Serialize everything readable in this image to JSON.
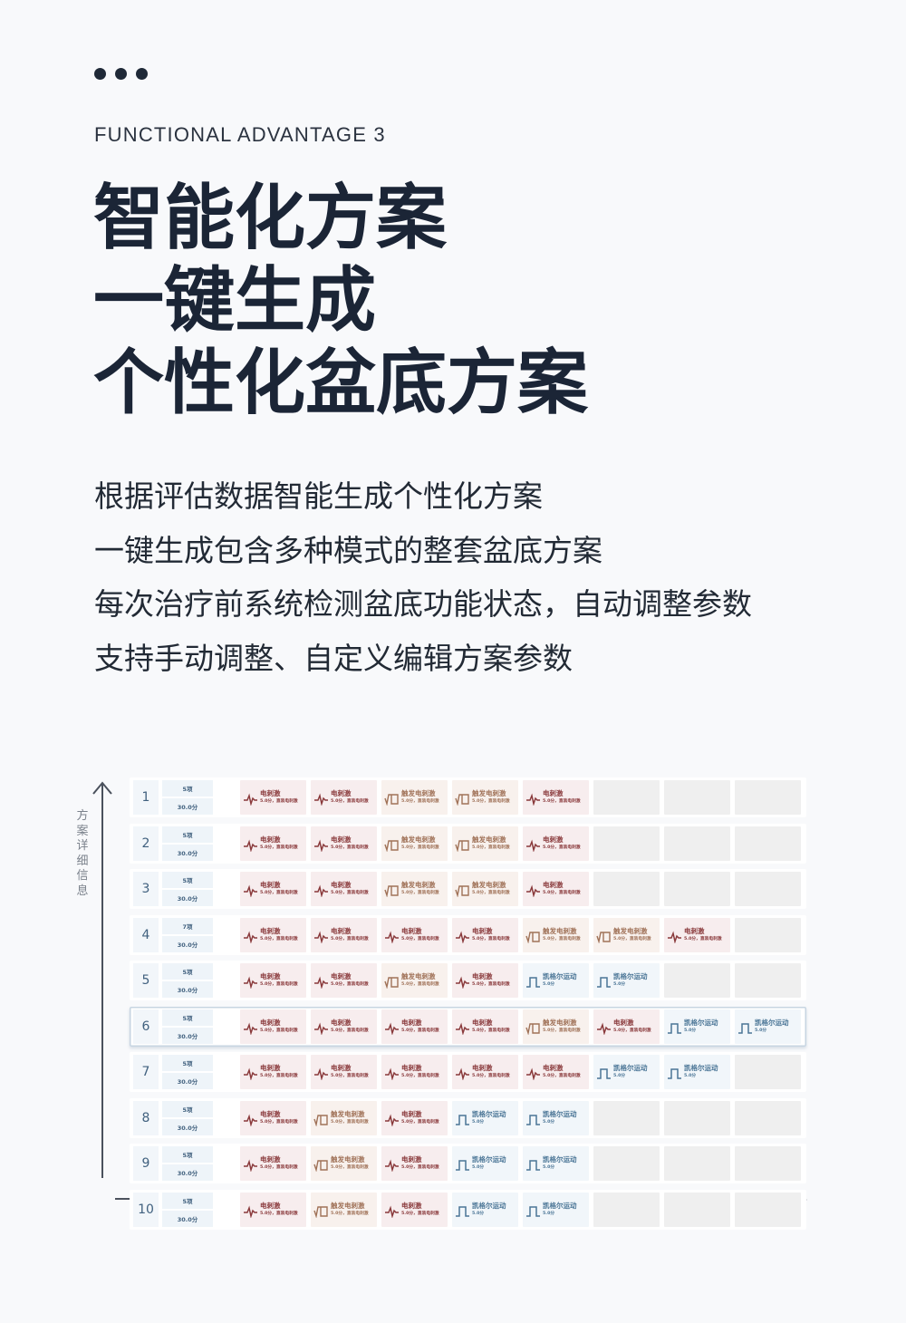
{
  "header": {
    "dots_icon": "ellipsis-icon",
    "eyebrow": "FUNCTIONAL ADVANTAGE 3",
    "headline": [
      "智能化方案",
      "一键生成",
      "个性化盆底方案"
    ]
  },
  "description": [
    "根据评估数据智能生成个性化方案",
    "一键生成包含多种模式的整套盆底方案",
    "每次治疗前系统检测盆底功能状态，自动调整参数",
    "支持手动调整、自定义编辑方案参数"
  ],
  "axes": {
    "y_label": "方案详细信息",
    "x_label": "方案详细信息"
  },
  "modes": {
    "estim": {
      "name": "电刺激",
      "sub": "5.0分，直装电刺激",
      "icon": "pulse-wave-icon",
      "color": "#8a3a3c"
    },
    "trigger": {
      "name": "触发电刺激",
      "sub": "5.0分，直装电刺激",
      "icon": "trigger-wave-icon",
      "color": "#a07258"
    },
    "kegel": {
      "name": "凯格尔运动",
      "sub": "5.0分",
      "icon": "square-wave-icon",
      "color": "#4a7596"
    },
    "empty": {
      "name": "",
      "sub": "",
      "icon": "",
      "color": "#efefef"
    }
  },
  "plans": [
    {
      "num": "1",
      "items": "5项",
      "duration": "30.0分",
      "selected": false,
      "cells": [
        "estim",
        "estim",
        "trigger",
        "trigger",
        "estim",
        "empty",
        "empty",
        "empty"
      ]
    },
    {
      "num": "2",
      "items": "5项",
      "duration": "30.0分",
      "selected": false,
      "cells": [
        "estim",
        "estim",
        "trigger",
        "trigger",
        "estim",
        "empty",
        "empty",
        "empty"
      ]
    },
    {
      "num": "3",
      "items": "5项",
      "duration": "30.0分",
      "selected": false,
      "cells": [
        "estim",
        "estim",
        "trigger",
        "trigger",
        "estim",
        "empty",
        "empty",
        "empty"
      ]
    },
    {
      "num": "4",
      "items": "7项",
      "duration": "30.0分",
      "selected": false,
      "cells": [
        "estim",
        "estim",
        "estim",
        "estim",
        "trigger",
        "trigger",
        "estim",
        "empty"
      ]
    },
    {
      "num": "5",
      "items": "5项",
      "duration": "30.0分",
      "selected": false,
      "cells": [
        "estim",
        "estim",
        "trigger",
        "estim",
        "kegel",
        "kegel",
        "empty",
        "empty"
      ]
    },
    {
      "num": "6",
      "items": "5项",
      "duration": "30.0分",
      "selected": true,
      "cells": [
        "estim",
        "estim",
        "estim",
        "estim",
        "trigger",
        "estim",
        "kegel",
        "kegel"
      ]
    },
    {
      "num": "7",
      "items": "5项",
      "duration": "30.0分",
      "selected": false,
      "cells": [
        "estim",
        "estim",
        "estim",
        "estim",
        "estim",
        "kegel",
        "kegel",
        "empty"
      ]
    },
    {
      "num": "8",
      "items": "5项",
      "duration": "30.0分",
      "selected": false,
      "cells": [
        "estim",
        "trigger",
        "estim",
        "kegel",
        "kegel",
        "empty",
        "empty",
        "empty"
      ]
    },
    {
      "num": "9",
      "items": "5项",
      "duration": "30.0分",
      "selected": false,
      "cells": [
        "estim",
        "trigger",
        "estim",
        "kegel",
        "kegel",
        "empty",
        "empty",
        "empty"
      ]
    },
    {
      "num": "10",
      "items": "5项",
      "duration": "30.0分",
      "selected": false,
      "cells": [
        "estim",
        "trigger",
        "estim",
        "kegel",
        "kegel",
        "empty",
        "empty",
        "empty"
      ]
    }
  ]
}
